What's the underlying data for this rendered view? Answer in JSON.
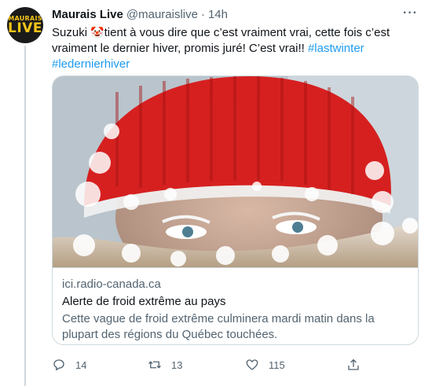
{
  "author": {
    "avatar_line1": "MAURAIS",
    "avatar_line2": "LIVE",
    "name": "Maurais Live",
    "handle": "@mauraislive",
    "separator": "·",
    "time": "14h"
  },
  "more_icon": "more-horizontal-icon",
  "tweet": {
    "text_part1": "Suzuki",
    "emoji": "🤡",
    "text_part2": "tient à vous dire que c’est vraiment vrai, cette fois c’est vraiment le dernier hiver, promis juré! C’est vrai!! ",
    "hashtag1": "#lastwinter",
    "hashtag2": "#ledernierhiver"
  },
  "card": {
    "domain": "ici.radio-canada.ca",
    "title": "Alerte de froid extrême au pays",
    "description": "Cette vague de froid extrême culminera mardi matin dans la plupart des régions du Québec touchées."
  },
  "actions": {
    "reply_count": "14",
    "retweet_count": "13",
    "like_count": "115"
  },
  "colors": {
    "link": "#1d9bf0",
    "muted": "#536471",
    "border": "#cfd9de"
  }
}
